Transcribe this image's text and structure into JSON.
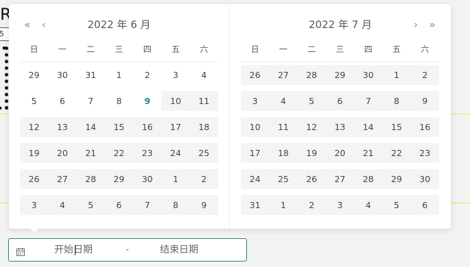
{
  "background": {
    "glyph": "R",
    "box_text": "5"
  },
  "calendar": {
    "weekdays": [
      "日",
      "一",
      "二",
      "三",
      "四",
      "五",
      "六"
    ],
    "left": {
      "title": "2022 年 6 月",
      "weeks": [
        [
          29,
          30,
          31,
          1,
          2,
          3,
          4
        ],
        [
          5,
          6,
          7,
          8,
          9,
          10,
          11
        ],
        [
          12,
          13,
          14,
          15,
          16,
          17,
          18
        ],
        [
          19,
          20,
          21,
          22,
          23,
          24,
          25
        ],
        [
          26,
          27,
          28,
          29,
          30,
          1,
          2
        ],
        [
          3,
          4,
          5,
          6,
          7,
          8,
          9
        ]
      ],
      "today": [
        1,
        4
      ],
      "shaded_from": [
        1,
        5
      ]
    },
    "right": {
      "title": "2022 年 7 月",
      "weeks": [
        [
          26,
          27,
          28,
          29,
          30,
          1,
          2
        ],
        [
          3,
          4,
          5,
          6,
          7,
          8,
          9
        ],
        [
          10,
          11,
          12,
          13,
          14,
          15,
          16
        ],
        [
          17,
          18,
          19,
          20,
          21,
          22,
          23
        ],
        [
          24,
          25,
          26,
          27,
          28,
          29,
          30
        ],
        [
          31,
          1,
          2,
          3,
          4,
          5,
          6
        ]
      ],
      "shaded_all": true
    },
    "nav": {
      "prev_year": "«",
      "prev_month": "‹",
      "next_month": "›",
      "next_year": "»"
    }
  },
  "range_input": {
    "icon": "calendar-icon",
    "start_placeholder": "开始日期",
    "separator": "-",
    "end_placeholder": "结束日期",
    "accent": "#2a7f80"
  }
}
